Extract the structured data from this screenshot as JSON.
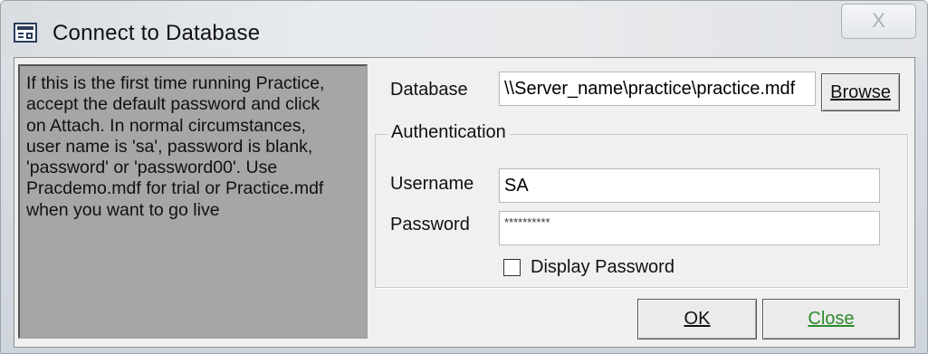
{
  "window": {
    "title": "Connect to Database",
    "close_glyph": "X"
  },
  "info": {
    "text": "If this is the first time running Practice,\naccept the default password and click\non Attach. In normal circumstances,\nuser name is 'sa', password is blank,\n'password' or 'password00'. Use\nPracdemo.mdf for trial or Practice.mdf\nwhen you want to go live"
  },
  "database": {
    "label": "Database",
    "value": "\\\\Server_name\\practice\\practice.mdf",
    "browse_label": "Browse"
  },
  "authentication": {
    "legend": "Authentication",
    "username_label": "Username",
    "username_value": "SA",
    "password_label": "Password",
    "password_value": "**********",
    "display_password_label": "Display Password",
    "display_password_checked": false
  },
  "footer": {
    "ok_label": "OK",
    "close_label": "Close"
  },
  "colors": {
    "info_panel_bg": "#a6a6a6",
    "close_button_text": "#2e8b2e",
    "dialog_bg": "#f0f0f0"
  },
  "icons": {
    "title_icon": "form-icon"
  }
}
